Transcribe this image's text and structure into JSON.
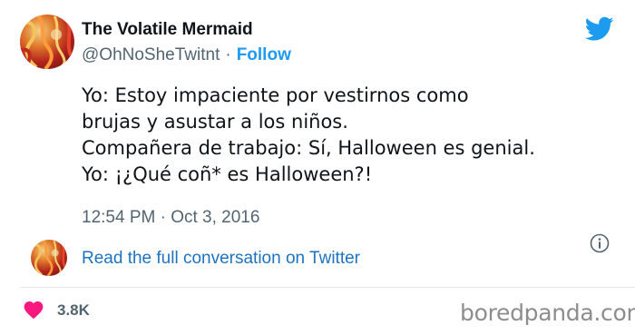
{
  "author": {
    "name": "The Volatile Mermaid",
    "handle": "@OhNoSheTwitnt",
    "separator": "·",
    "follow_label": "Follow"
  },
  "tweet": {
    "lines": [
      "Yo: Estoy impaciente por vestirnos como",
      "brujas y asustar a los niños.",
      "Compañera de trabajo: Sí, Halloween es genial.",
      "Yo:  ¡¿Qué coñ* es Halloween?!"
    ],
    "timestamp": "12:54 PM · Oct 3, 2016"
  },
  "conversation_link": "Read the full conversation on Twitter",
  "engagement": {
    "likes": "3.8K",
    "heart_color": "#f91880"
  },
  "brand": {
    "platform_icon": "twitter-bird-icon",
    "accent": "#1d9bf0"
  },
  "watermark": "boredpanda.com"
}
